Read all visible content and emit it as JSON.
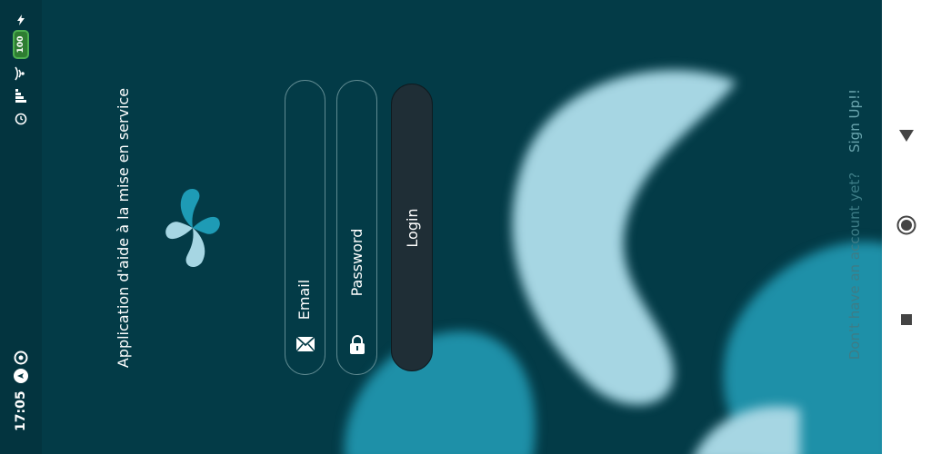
{
  "status_bar": {
    "time": "17:05",
    "battery": "100",
    "icons": [
      "location-icon",
      "speed-icon",
      "alarm-icon",
      "signal-icon",
      "wifi-icon",
      "battery-icon",
      "charging-icon"
    ]
  },
  "app": {
    "title": "Application d'aide à la mise en service",
    "logo": "pinwheel-logo"
  },
  "form": {
    "email_placeholder": "Email",
    "password_placeholder": "Password",
    "login_label": "Login"
  },
  "footer": {
    "prompt": "Don't have an account yet?",
    "signup_label": "Sign Up!!"
  },
  "nav": {
    "back": "back-triangle-icon",
    "home": "home-circle-icon",
    "recents": "recents-square-icon"
  },
  "colors": {
    "background": "#033b47",
    "blob_light": "#a6d6e3",
    "blob_teal": "#1e90a8",
    "button": "#1f2e36",
    "text": "#ffffff"
  }
}
